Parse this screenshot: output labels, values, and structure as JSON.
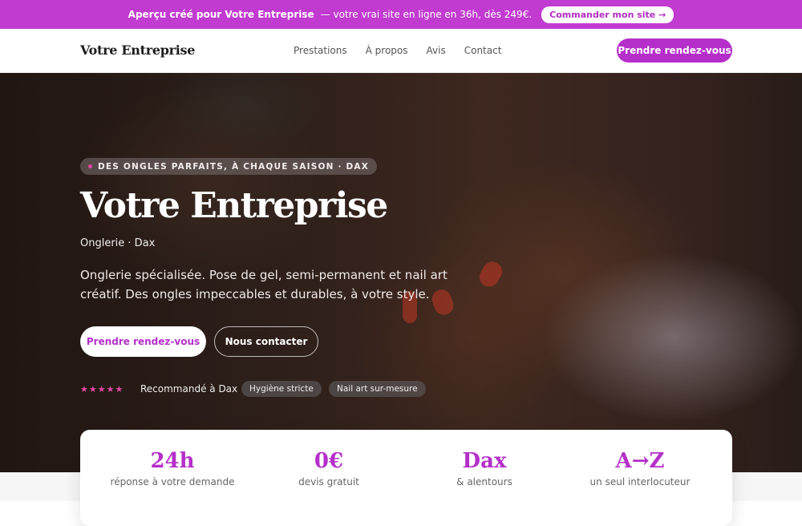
{
  "promo": {
    "bold": "Aperçu créé pour Votre Entreprise",
    "text": "— votre vrai site en ligne en 36h, dès 249€.",
    "button": "Commander mon site →"
  },
  "nav": {
    "brand": "Votre Entreprise",
    "items": [
      "Prestations",
      "À propos",
      "Avis",
      "Contact"
    ],
    "cta": "Prendre rendez-vous"
  },
  "hero": {
    "tagline": "DES ONGLES PARFAITS, À CHAQUE SAISON · DAX",
    "title": "Votre Entreprise",
    "subtitle": "Onglerie · Dax",
    "description": "Onglerie spécialisée. Pose de gel, semi-permanent et nail art créatif. Des ongles impeccables et durables, à votre style.",
    "primary_button": "Prendre rendez-vous",
    "secondary_button": "Nous contacter",
    "stars": "★★★★★",
    "recommended": "Recommandé à Dax",
    "chips": [
      "Hygiène stricte",
      "Nail art sur-mesure"
    ]
  },
  "stats": [
    {
      "value": "24h",
      "label": "réponse à votre demande"
    },
    {
      "value": "0€",
      "label": "devis gratuit"
    },
    {
      "value": "Dax",
      "label": "& alentours"
    },
    {
      "value": "A→Z",
      "label": "un seul interlocuteur"
    }
  ],
  "colors": {
    "accent": "#b42fc9",
    "promo_bg": "#c13bd0",
    "star": "#e24aa6"
  }
}
